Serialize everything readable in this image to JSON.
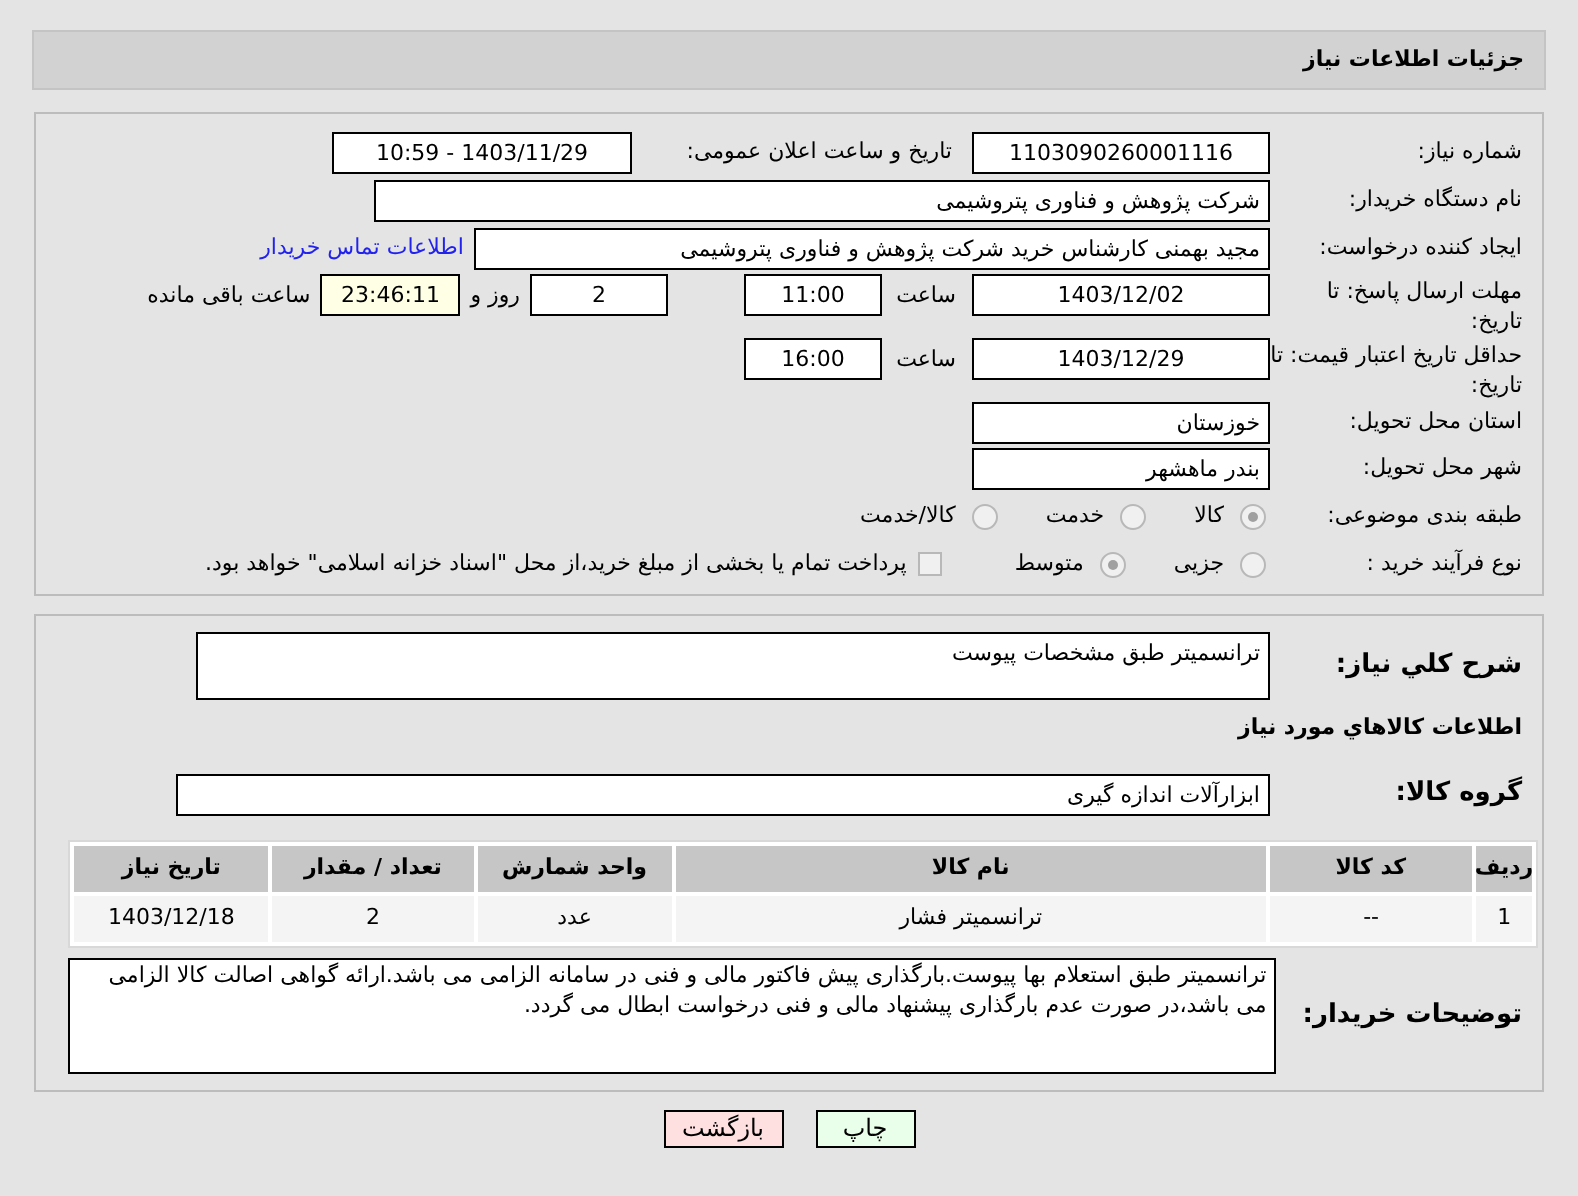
{
  "header": {
    "title": "جزئیات اطلاعات نیاز"
  },
  "details": {
    "need_number": {
      "label": "شماره نیاز:",
      "value": "1103090260001116"
    },
    "announce": {
      "label": "تاریخ و ساعت اعلان عمومی:",
      "value": "1403/11/29 - 10:59"
    },
    "buyer": {
      "label": "نام دستگاه خریدار:",
      "value": "شرکت پژوهش و فناوری پتروشیمی"
    },
    "creator": {
      "label": "ایجاد کننده درخواست:",
      "value": "مجید بهمنی کارشناس خرید شرکت پژوهش و فناوری پتروشیمی",
      "link": "اطلاعات تماس خریدار"
    },
    "deadline": {
      "label": "مهلت ارسال پاسخ: تا تاریخ:",
      "date": "1403/12/02",
      "time_label": "ساعت",
      "time": "11:00",
      "days": "2",
      "days_label": "روز و",
      "remaining": "23:46:11",
      "remaining_label": "ساعت باقی مانده"
    },
    "validity": {
      "label": "حداقل تاریخ اعتبار قیمت: تا تاریخ:",
      "date": "1403/12/29",
      "time_label": "ساعت",
      "time": "16:00"
    },
    "province": {
      "label": "استان محل تحویل:",
      "value": "خوزستان"
    },
    "city": {
      "label": "شهر محل تحویل:",
      "value": "بندر ماهشهر"
    },
    "category": {
      "label": "طبقه بندی موضوعی:",
      "options": [
        {
          "label": "کالا",
          "selected": true
        },
        {
          "label": "خدمت",
          "selected": false
        },
        {
          "label": "کالا/خدمت",
          "selected": false
        }
      ]
    },
    "process": {
      "label": "نوع فرآیند خرید :",
      "options": [
        {
          "label": "جزیی",
          "selected": false
        },
        {
          "label": "متوسط",
          "selected": true
        }
      ],
      "payment": {
        "label": "پرداخت تمام یا بخشی از مبلغ خرید،از محل \"اسناد خزانه اسلامی\" خواهد بود.",
        "checked": false
      }
    }
  },
  "goods": {
    "description": {
      "label": "شرح كلي نياز:",
      "value": "ترانسمیتر طبق مشخصات پیوست"
    },
    "section_title": "اطلاعات كالاهاي مورد نياز",
    "group": {
      "label": "گروه کالا:",
      "value": "ابزارآلات اندازه گیری"
    },
    "table": {
      "columns": [
        "ردیف",
        "کد کالا",
        "نام کالا",
        "واحد شمارش",
        "تعداد / مقدار",
        "تاریخ نیاز"
      ],
      "rows": [
        [
          "1",
          "--",
          "ترانسمیتر فشار",
          "عدد",
          "2",
          "1403/12/18"
        ]
      ]
    },
    "notes": {
      "label": "توضیحات خریدار:",
      "value": "ترانسمیتر طبق استعلام بها پیوست.بارگذاری پیش فاکتور مالی و فنی در سامانه الزامی می باشد.ارائه گواهی اصالت کالا الزامی می باشد،در صورت عدم بارگذاری پیشنهاد مالی و فنی درخواست ابطال می گردد."
    }
  },
  "buttons": [
    {
      "label": "چاپ",
      "kind": "print"
    },
    {
      "label": "بازگشت",
      "kind": "back"
    }
  ]
}
